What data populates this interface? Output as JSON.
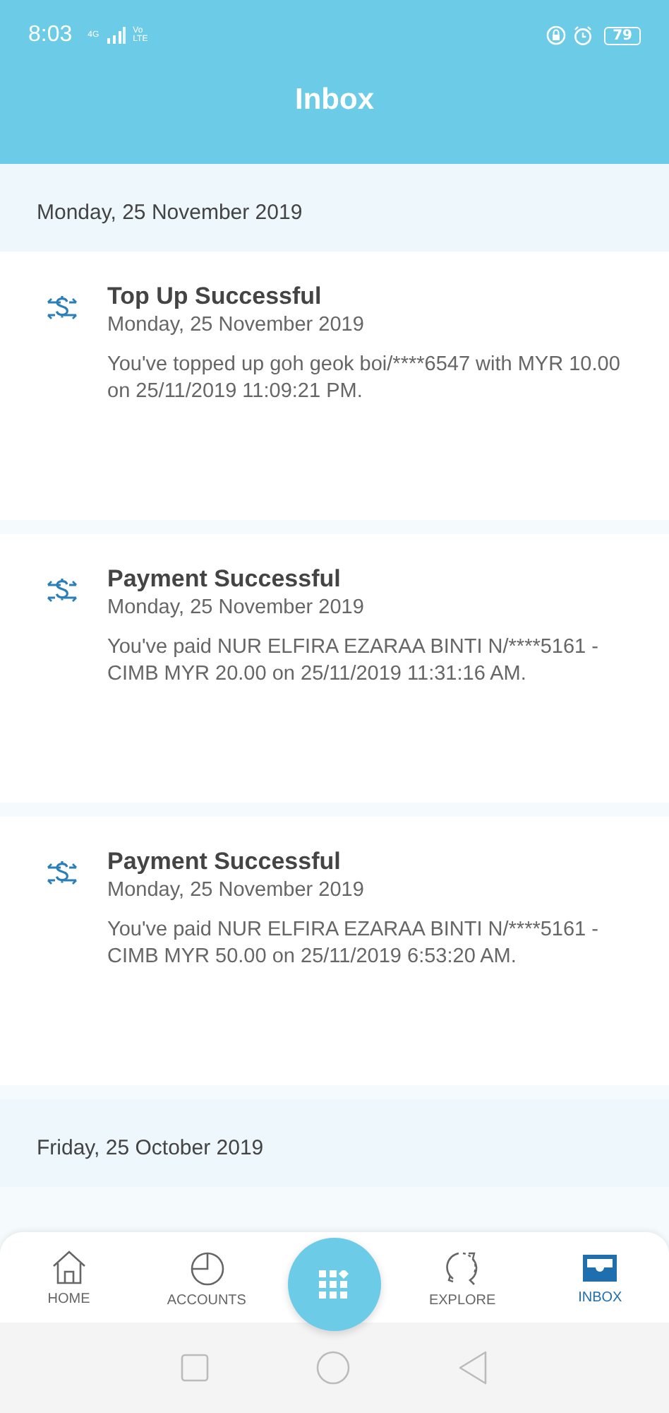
{
  "status_bar": {
    "time": "8:03",
    "network": "4G",
    "volte": "Vo LTE",
    "battery": "79"
  },
  "header": {
    "title": "Inbox"
  },
  "groups": [
    {
      "date": "Monday, 25 November 2019",
      "messages": [
        {
          "title": "Top Up Successful",
          "date": "Monday, 25 November 2019",
          "body": "You've topped up goh geok boi/****6547 with MYR 10.00 on 25/11/2019 11:09:21 PM."
        },
        {
          "title": "Payment Successful",
          "date": "Monday, 25 November 2019",
          "body": "You've paid NUR ELFIRA EZARAA BINTI N/****5161 - CIMB MYR 20.00 on 25/11/2019 11:31:16 AM."
        },
        {
          "title": "Payment Successful",
          "date": "Monday, 25 November 2019",
          "body": "You've paid NUR ELFIRA EZARAA BINTI N/****5161 - CIMB MYR 50.00 on 25/11/2019 6:53:20 AM."
        }
      ]
    },
    {
      "date": "Friday, 25 October 2019"
    }
  ],
  "bottom_nav": [
    {
      "kind": "home",
      "label": "HOME",
      "selected": false
    },
    {
      "kind": "accounts",
      "label": "ACCOUNTS",
      "selected": false
    },
    {
      "kind": "menu",
      "selected": false
    },
    {
      "kind": "explore",
      "label": "EXPLORE",
      "selected": false
    },
    {
      "kind": "inbox",
      "label": "INBOX",
      "selected": true
    }
  ]
}
